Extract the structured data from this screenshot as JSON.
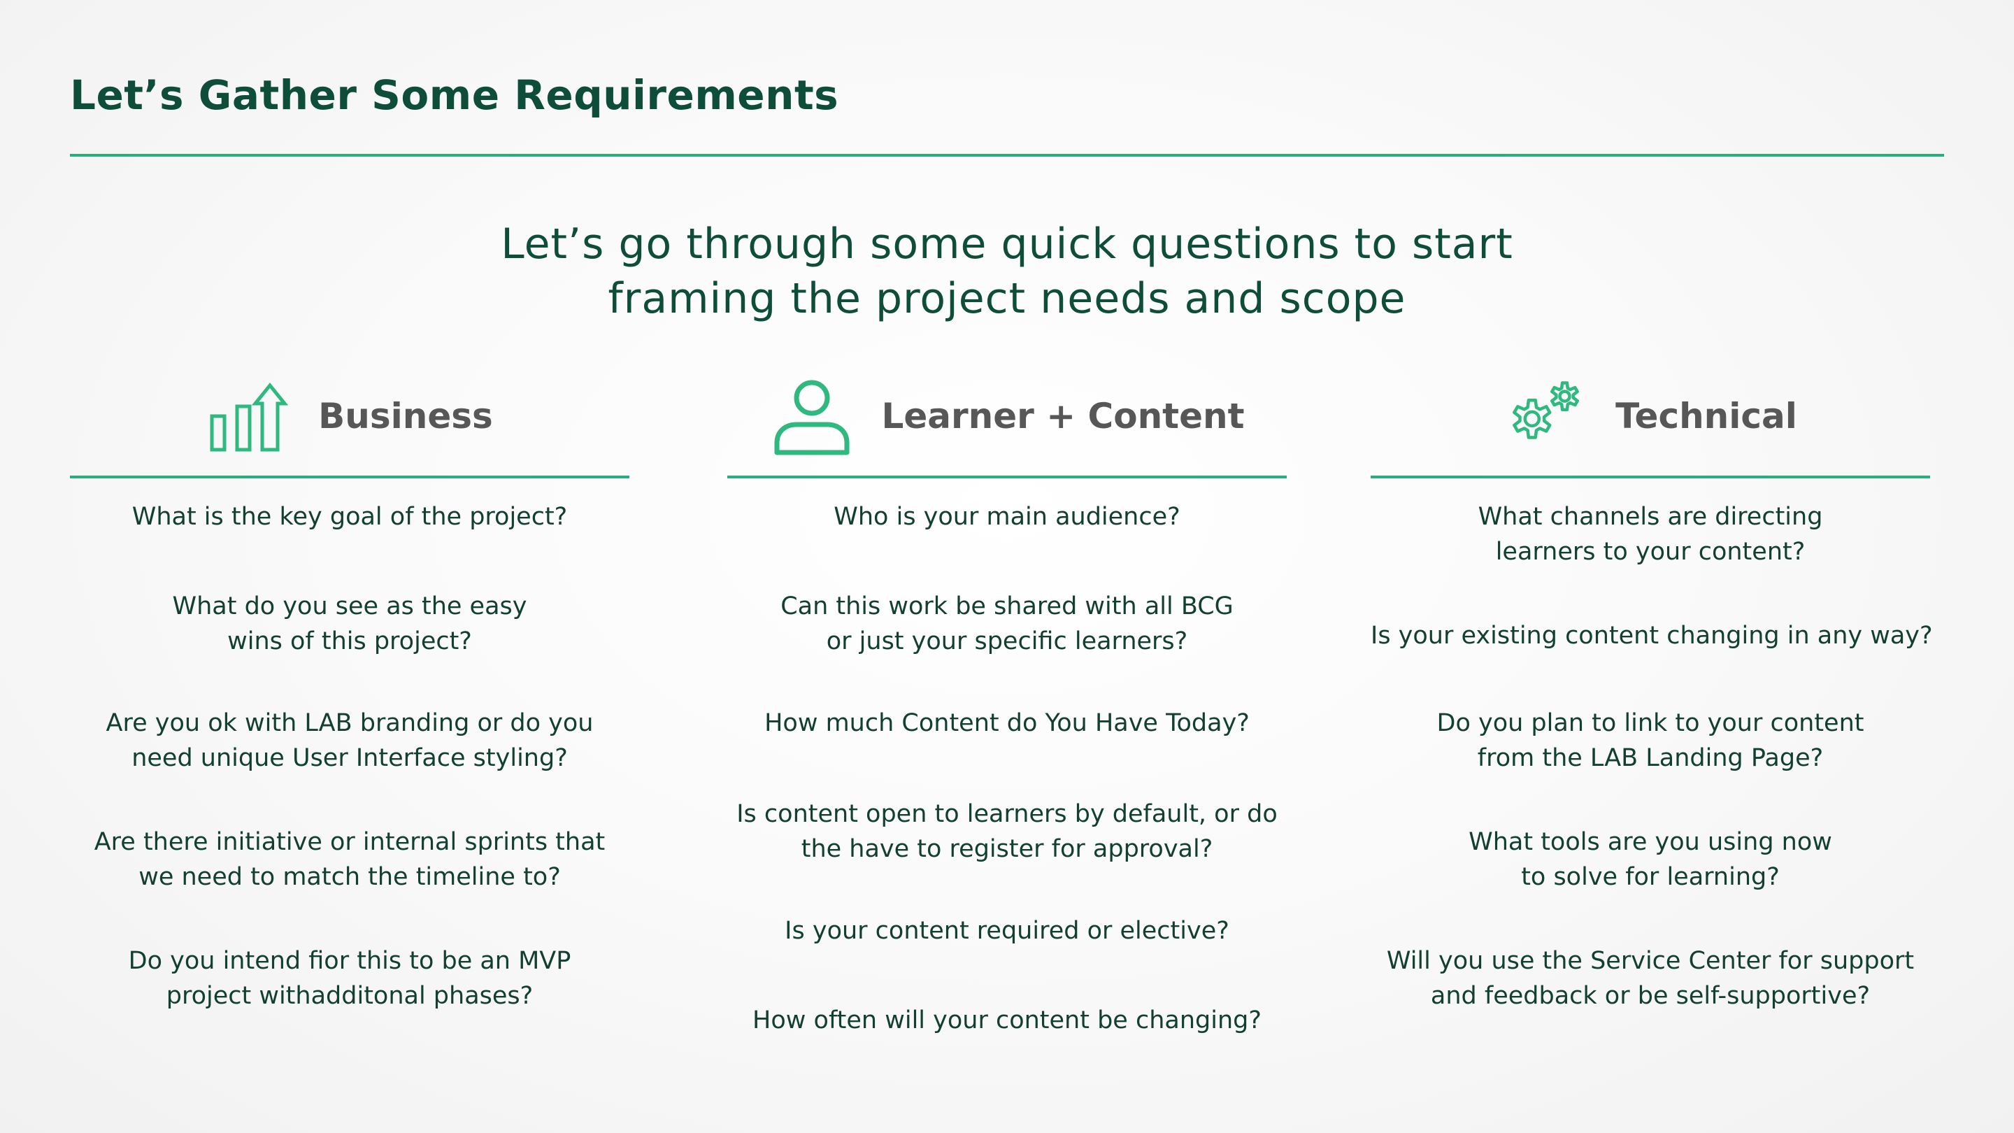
{
  "page": {
    "title": "Let’s Gather Some Requirements",
    "subtitle_line1": "Let’s go through some quick questions to start",
    "subtitle_line2": "framing the project needs and scope"
  },
  "colors": {
    "accent": "#2bae7e",
    "heading": "#0e4d39",
    "column_title": "#575757",
    "body_text": "#123f31",
    "icon_stroke": "#2fb87f"
  },
  "columns": [
    {
      "title": "Business",
      "icon": "chart-growth-icon",
      "questions": [
        [
          "What is the key goal of the project?"
        ],
        [
          "What do you see as the easy",
          "wins of this project?"
        ],
        [
          "Are you ok with LAB branding or do you",
          "need unique User Interface styling?"
        ],
        [
          "Are there initiative or internal sprints that",
          "we need to match the timeline to?"
        ],
        [
          "Do you intend fior this to be an MVP",
          "project withadditonal phases?"
        ]
      ]
    },
    {
      "title": "Learner + Content",
      "icon": "user-icon",
      "questions": [
        [
          "Who is your main audience?"
        ],
        [
          "Can this work be shared with all BCG",
          "or just your specific learners?"
        ],
        [
          "How much Content do You Have Today?"
        ],
        [
          "Is content open to learners by default, or do",
          "the have to register for approval?"
        ],
        [
          "Is your content required or elective?"
        ],
        [
          "How often will your content be changing?"
        ]
      ]
    },
    {
      "title": "Technical",
      "icon": "gears-icon",
      "questions": [
        [
          "What channels are directing",
          "learners to your content?"
        ],
        [
          "Is your existing content changing in any way?"
        ],
        [
          "Do you plan to link to your content",
          "from the LAB Landing Page?"
        ],
        [
          "What tools are you using now",
          "to solve for learning?"
        ],
        [
          "Will you use the Service Center for support",
          "and feedback or be self-supportive?"
        ]
      ]
    }
  ]
}
